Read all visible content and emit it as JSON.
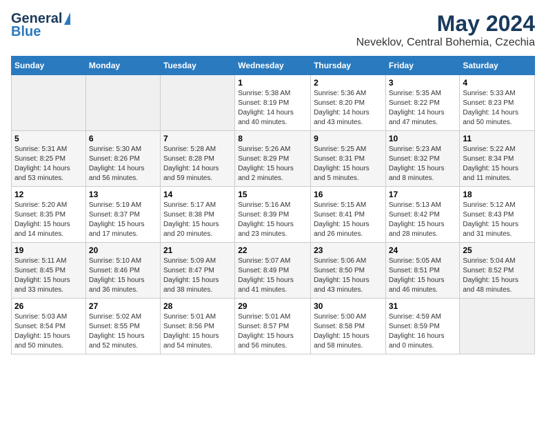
{
  "logo": {
    "line1": "General",
    "line2": "Blue"
  },
  "title": "May 2024",
  "subtitle": "Neveklov, Central Bohemia, Czechia",
  "days_of_week": [
    "Sunday",
    "Monday",
    "Tuesday",
    "Wednesday",
    "Thursday",
    "Friday",
    "Saturday"
  ],
  "weeks": [
    [
      {
        "num": "",
        "info": ""
      },
      {
        "num": "",
        "info": ""
      },
      {
        "num": "",
        "info": ""
      },
      {
        "num": "1",
        "info": "Sunrise: 5:38 AM\nSunset: 8:19 PM\nDaylight: 14 hours\nand 40 minutes."
      },
      {
        "num": "2",
        "info": "Sunrise: 5:36 AM\nSunset: 8:20 PM\nDaylight: 14 hours\nand 43 minutes."
      },
      {
        "num": "3",
        "info": "Sunrise: 5:35 AM\nSunset: 8:22 PM\nDaylight: 14 hours\nand 47 minutes."
      },
      {
        "num": "4",
        "info": "Sunrise: 5:33 AM\nSunset: 8:23 PM\nDaylight: 14 hours\nand 50 minutes."
      }
    ],
    [
      {
        "num": "5",
        "info": "Sunrise: 5:31 AM\nSunset: 8:25 PM\nDaylight: 14 hours\nand 53 minutes."
      },
      {
        "num": "6",
        "info": "Sunrise: 5:30 AM\nSunset: 8:26 PM\nDaylight: 14 hours\nand 56 minutes."
      },
      {
        "num": "7",
        "info": "Sunrise: 5:28 AM\nSunset: 8:28 PM\nDaylight: 14 hours\nand 59 minutes."
      },
      {
        "num": "8",
        "info": "Sunrise: 5:26 AM\nSunset: 8:29 PM\nDaylight: 15 hours\nand 2 minutes."
      },
      {
        "num": "9",
        "info": "Sunrise: 5:25 AM\nSunset: 8:31 PM\nDaylight: 15 hours\nand 5 minutes."
      },
      {
        "num": "10",
        "info": "Sunrise: 5:23 AM\nSunset: 8:32 PM\nDaylight: 15 hours\nand 8 minutes."
      },
      {
        "num": "11",
        "info": "Sunrise: 5:22 AM\nSunset: 8:34 PM\nDaylight: 15 hours\nand 11 minutes."
      }
    ],
    [
      {
        "num": "12",
        "info": "Sunrise: 5:20 AM\nSunset: 8:35 PM\nDaylight: 15 hours\nand 14 minutes."
      },
      {
        "num": "13",
        "info": "Sunrise: 5:19 AM\nSunset: 8:37 PM\nDaylight: 15 hours\nand 17 minutes."
      },
      {
        "num": "14",
        "info": "Sunrise: 5:17 AM\nSunset: 8:38 PM\nDaylight: 15 hours\nand 20 minutes."
      },
      {
        "num": "15",
        "info": "Sunrise: 5:16 AM\nSunset: 8:39 PM\nDaylight: 15 hours\nand 23 minutes."
      },
      {
        "num": "16",
        "info": "Sunrise: 5:15 AM\nSunset: 8:41 PM\nDaylight: 15 hours\nand 26 minutes."
      },
      {
        "num": "17",
        "info": "Sunrise: 5:13 AM\nSunset: 8:42 PM\nDaylight: 15 hours\nand 28 minutes."
      },
      {
        "num": "18",
        "info": "Sunrise: 5:12 AM\nSunset: 8:43 PM\nDaylight: 15 hours\nand 31 minutes."
      }
    ],
    [
      {
        "num": "19",
        "info": "Sunrise: 5:11 AM\nSunset: 8:45 PM\nDaylight: 15 hours\nand 33 minutes."
      },
      {
        "num": "20",
        "info": "Sunrise: 5:10 AM\nSunset: 8:46 PM\nDaylight: 15 hours\nand 36 minutes."
      },
      {
        "num": "21",
        "info": "Sunrise: 5:09 AM\nSunset: 8:47 PM\nDaylight: 15 hours\nand 38 minutes."
      },
      {
        "num": "22",
        "info": "Sunrise: 5:07 AM\nSunset: 8:49 PM\nDaylight: 15 hours\nand 41 minutes."
      },
      {
        "num": "23",
        "info": "Sunrise: 5:06 AM\nSunset: 8:50 PM\nDaylight: 15 hours\nand 43 minutes."
      },
      {
        "num": "24",
        "info": "Sunrise: 5:05 AM\nSunset: 8:51 PM\nDaylight: 15 hours\nand 46 minutes."
      },
      {
        "num": "25",
        "info": "Sunrise: 5:04 AM\nSunset: 8:52 PM\nDaylight: 15 hours\nand 48 minutes."
      }
    ],
    [
      {
        "num": "26",
        "info": "Sunrise: 5:03 AM\nSunset: 8:54 PM\nDaylight: 15 hours\nand 50 minutes."
      },
      {
        "num": "27",
        "info": "Sunrise: 5:02 AM\nSunset: 8:55 PM\nDaylight: 15 hours\nand 52 minutes."
      },
      {
        "num": "28",
        "info": "Sunrise: 5:01 AM\nSunset: 8:56 PM\nDaylight: 15 hours\nand 54 minutes."
      },
      {
        "num": "29",
        "info": "Sunrise: 5:01 AM\nSunset: 8:57 PM\nDaylight: 15 hours\nand 56 minutes."
      },
      {
        "num": "30",
        "info": "Sunrise: 5:00 AM\nSunset: 8:58 PM\nDaylight: 15 hours\nand 58 minutes."
      },
      {
        "num": "31",
        "info": "Sunrise: 4:59 AM\nSunset: 8:59 PM\nDaylight: 16 hours\nand 0 minutes."
      },
      {
        "num": "",
        "info": ""
      }
    ]
  ]
}
